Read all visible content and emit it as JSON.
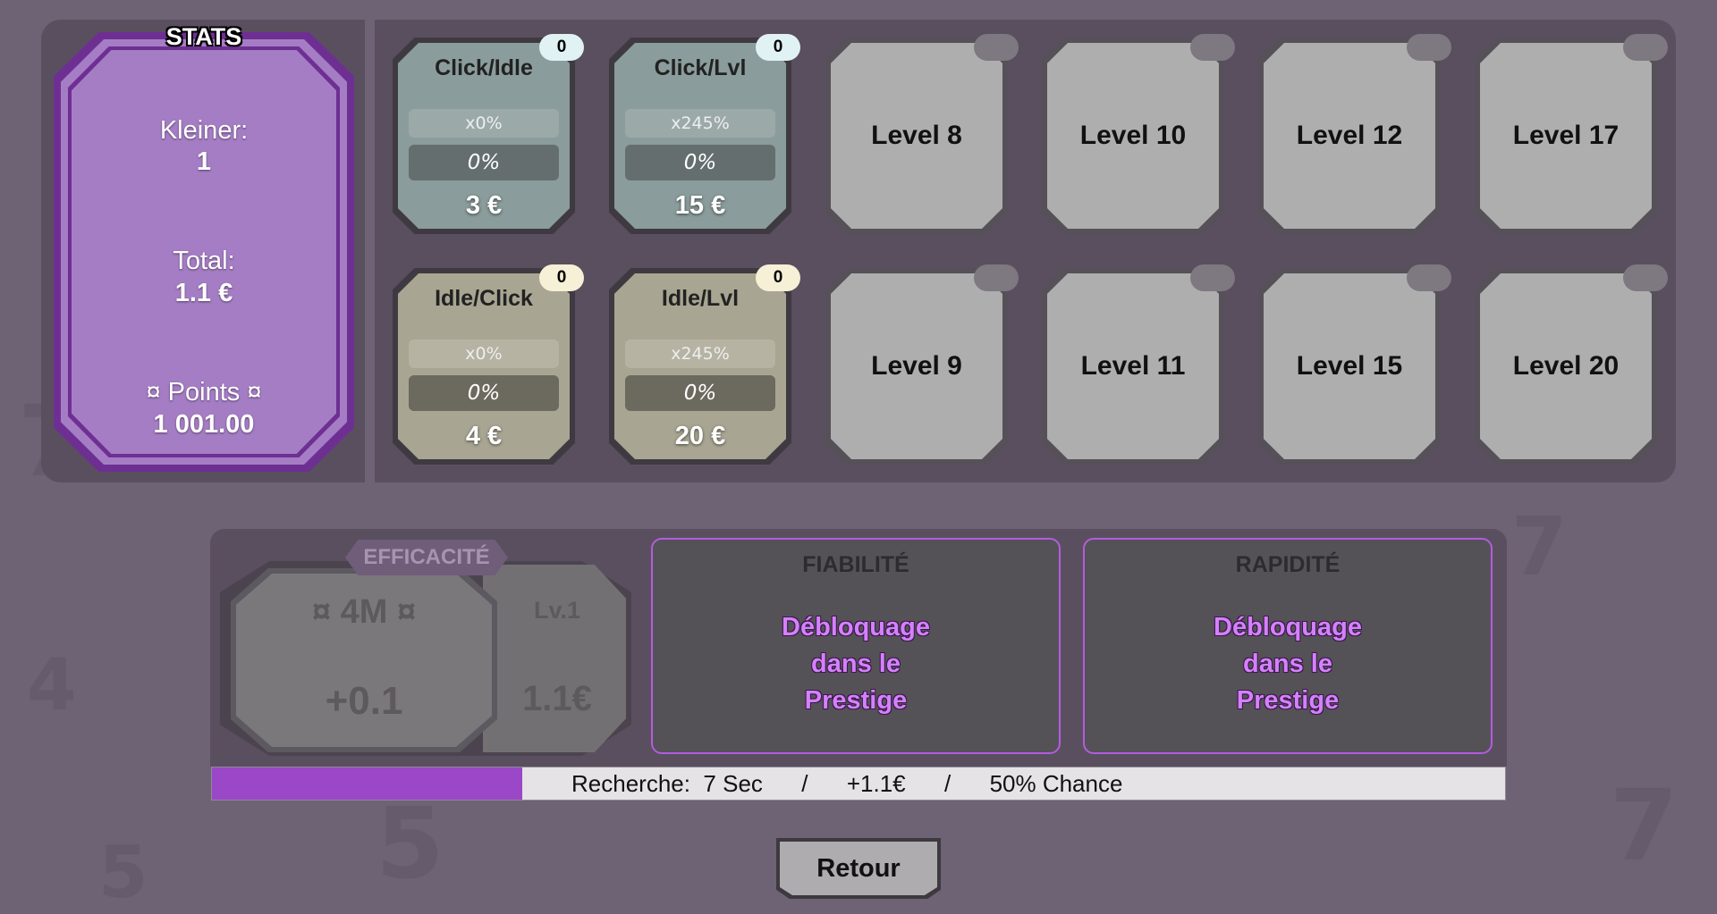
{
  "stats": {
    "title": "STATS",
    "kleiner_label": "Kleiner:",
    "kleiner_value": "1",
    "total_label": "Total:",
    "total_value": "1.1 €",
    "points_label": "¤ Points ¤",
    "points_value": "1 001.00"
  },
  "upgrades": [
    {
      "title": "Click/Idle",
      "multiplier": "x0%",
      "percent": "0%",
      "price": "3 €",
      "count": "0"
    },
    {
      "title": "Click/Lvl",
      "multiplier": "x245%",
      "percent": "0%",
      "price": "15 €",
      "count": "0"
    },
    {
      "title": "Idle/Click",
      "multiplier": "x0%",
      "percent": "0%",
      "price": "4 €",
      "count": "0"
    },
    {
      "title": "Idle/Lvl",
      "multiplier": "x245%",
      "percent": "0%",
      "price": "20 €",
      "count": "0"
    }
  ],
  "locked_levels": [
    "Level 8",
    "Level 10",
    "Level 12",
    "Level 17",
    "Level 9",
    "Level 11",
    "Level 15",
    "Level 20"
  ],
  "efficacite": {
    "tag": "EFFICACITÉ",
    "cost": "¤ 4M ¤",
    "gain": "+0.1",
    "level": "Lv.1",
    "value": "1.1€"
  },
  "fiabilite": {
    "title": "FIABILITÉ",
    "message_lines": [
      "Débloquage",
      "dans le",
      "Prestige"
    ]
  },
  "rapidite": {
    "title": "RAPIDITÉ",
    "message_lines": [
      "Débloquage",
      "dans le",
      "Prestige"
    ]
  },
  "progress": {
    "fill_fraction": 0.24,
    "label": "Recherche:",
    "time": "7 Sec",
    "separator": "/",
    "gain": "+1.1€",
    "chance": "50% Chance"
  },
  "retour_label": "Retour",
  "colors": {
    "accent_purple": "#9a47c8",
    "stats_fill": "#a57dc4",
    "unlock_text": "#d580ff"
  }
}
